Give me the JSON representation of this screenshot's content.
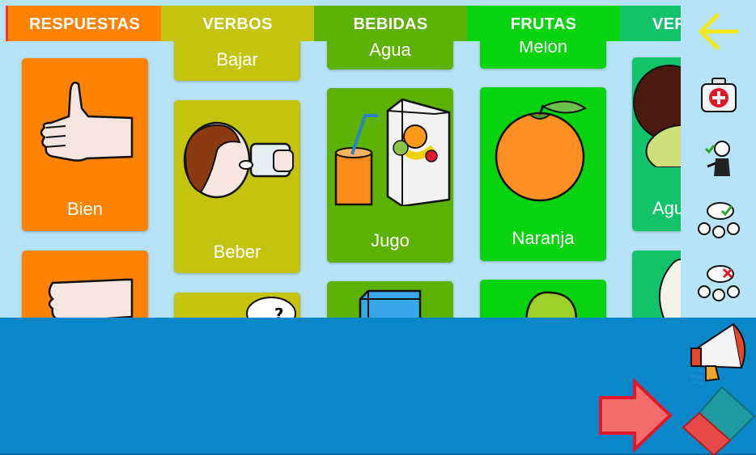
{
  "tabs": [
    {
      "label": "RESPUESTAS",
      "color": "#ff8200"
    },
    {
      "label": "VERBOS",
      "color": "#c4c40e"
    },
    {
      "label": "BEBIDAS",
      "color": "#5db100"
    },
    {
      "label": "FRUTAS",
      "color": "#07d40e"
    },
    {
      "label": "VER",
      "color": "#11c46a"
    }
  ],
  "cards": {
    "bajar": "Bajar",
    "agua": "Agua",
    "melon": "Melón",
    "bien": "Bien",
    "beber": "Beber",
    "jugo": "Jugo",
    "naranja": "Naranja",
    "agu": "Agu"
  },
  "colors": {
    "background": "#b6e3f7",
    "bottom_bar": "#0a87c8",
    "respuestas": "#ff8200",
    "verbos": "#c4c40e",
    "bebidas": "#5db100",
    "frutas": "#07d40e",
    "verduras": "#11c46a"
  },
  "icons": [
    "back-arrow-icon",
    "first-aid-kit-icon",
    "person-ok-icon",
    "yes-speech-icon",
    "no-speech-icon",
    "megaphone-icon",
    "next-arrow-icon",
    "eraser-icon"
  ]
}
